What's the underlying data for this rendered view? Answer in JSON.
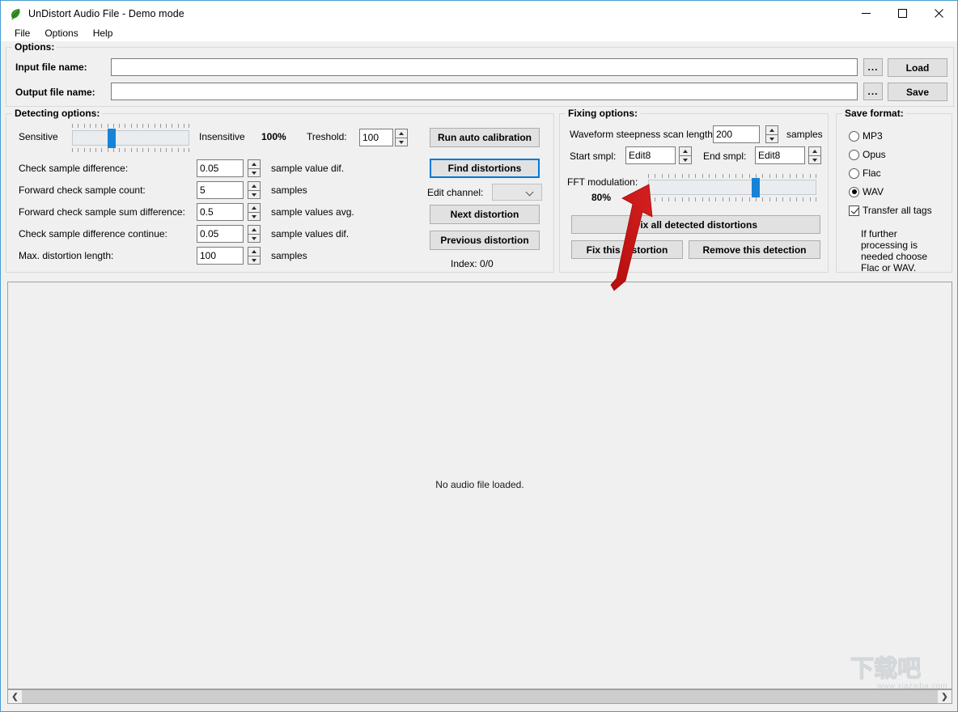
{
  "window": {
    "title": "UnDistort Audio File - Demo mode",
    "icon": "app-leaf-icon",
    "minimize": "minimize-icon",
    "maximize": "maximize-icon",
    "close": "close-icon"
  },
  "menu": {
    "items": [
      {
        "label": "File"
      },
      {
        "label": "Options"
      },
      {
        "label": "Help"
      }
    ]
  },
  "options_group": {
    "title": "Options:",
    "input_file": {
      "label": "Input file name:",
      "value": "",
      "placeholder": "",
      "browse_label": "...",
      "action_label": "Load"
    },
    "output_file": {
      "label": "Output file name:",
      "value": "",
      "placeholder": "",
      "browse_label": "...",
      "action_label": "Save"
    }
  },
  "detecting_options": {
    "title": "Detecting options:",
    "sensitivity": {
      "min_label": "Sensitive",
      "max_label": "Insensitive",
      "percent_label": "100%",
      "value_percent": 100,
      "thumb_position_pct": 32
    },
    "threshold": {
      "label": "Treshold:",
      "value": "100"
    },
    "fields": [
      {
        "label": "Check sample difference:",
        "value": "0.05",
        "unit": "sample value dif."
      },
      {
        "label": "Forward check sample count:",
        "value": "5",
        "unit": "samples"
      },
      {
        "label": "Forward check sample sum difference:",
        "value": "0.5",
        "unit": "sample values avg."
      },
      {
        "label": "Check sample difference continue:",
        "value": "0.05",
        "unit": "sample values dif."
      },
      {
        "label": "Max. distortion length:",
        "value": "100",
        "unit": "samples"
      }
    ],
    "buttons": {
      "run_auto_calibration": "Run auto calibration",
      "find_distortions": "Find distortions",
      "next_distortion": "Next distortion",
      "previous_distortion": "Previous distortion"
    },
    "edit_channel": {
      "label": "Edit channel:",
      "value": ""
    },
    "index_label": "Index: 0/0"
  },
  "fixing_options": {
    "title": "Fixing options:",
    "scan_length": {
      "label": "Waveform steepness scan length:",
      "value": "200",
      "unit": "samples"
    },
    "start_smpl": {
      "label": "Start smpl:",
      "value": "Edit8"
    },
    "end_smpl": {
      "label": "End smpl:",
      "value": "Edit8"
    },
    "fft_modulation": {
      "label": "FFT modulation:",
      "percent_label": "80%",
      "value_percent": 80,
      "thumb_position_pct": 64
    },
    "buttons": {
      "fix_all": "Fix all detected distortions",
      "fix_this": "Fix this distortion",
      "remove_detection": "Remove this detection"
    }
  },
  "save_format": {
    "title": "Save format:",
    "options": [
      {
        "label": "MP3",
        "selected": false
      },
      {
        "label": "Opus",
        "selected": false
      },
      {
        "label": "Flac",
        "selected": false
      },
      {
        "label": "WAV",
        "selected": true
      }
    ],
    "transfer_tags": {
      "label": "Transfer all tags",
      "checked": true
    },
    "note": "If further processing is needed choose Flac or WAV."
  },
  "waveform": {
    "message": "No audio file loaded."
  },
  "scrollbar": {
    "left_arrow": "chevron-left-icon",
    "right_arrow": "chevron-right-icon"
  },
  "annotation": {
    "arrow_color": "#cc1111"
  },
  "watermark": {
    "text": "下载吧",
    "url": "www.xiazaiba.com"
  },
  "colors": {
    "accent": "#1683d8",
    "focus": "#0078d7",
    "window_border": "#4a9bd1",
    "panel_bg": "#f0f0f0",
    "button_bg": "#e1e1e1"
  }
}
